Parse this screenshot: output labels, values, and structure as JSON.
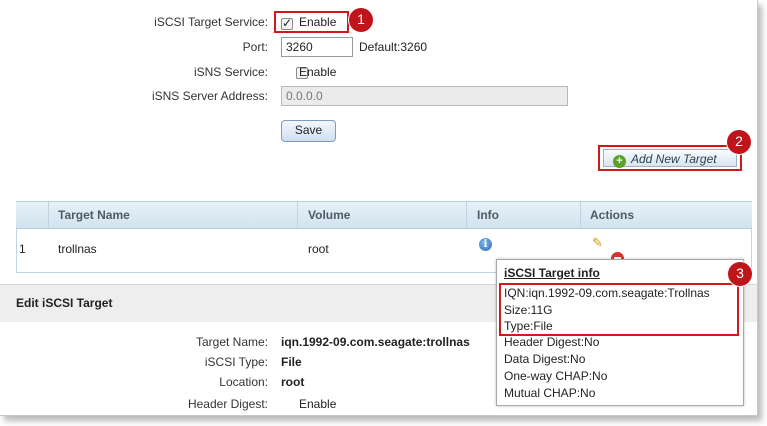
{
  "service": {
    "target_service_label": "iSCSI Target Service:",
    "target_service_enable": "Enable",
    "port_label": "Port:",
    "port_value": "3260",
    "port_default": "Default:3260",
    "isns_label": "iSNS Service:",
    "isns_enable": "Enable",
    "isns_server_label": "iSNS Server Address:",
    "isns_server_value": "0.0.0.0",
    "save_label": "Save"
  },
  "add_target_label": "Add New Target",
  "callouts": [
    "1",
    "2",
    "3"
  ],
  "table": {
    "headers": [
      "Target Name",
      "Volume",
      "Info",
      "Actions"
    ],
    "rows": [
      {
        "index": "1",
        "name": "trollnas",
        "volume": "root"
      }
    ]
  },
  "edit": {
    "title": "Edit iSCSI Target",
    "target_name_label": "Target Name:",
    "target_name_value": "iqn.1992-09.com.seagate:trollnas",
    "type_label": "iSCSI Type:",
    "type_value": "File",
    "location_label": "Location:",
    "location_value": "root",
    "header_digest_label": "Header Digest:",
    "header_digest_enable": "Enable"
  },
  "popup": {
    "title": "iSCSI Target info",
    "lines": [
      "IQN:iqn.1992-09.com.seagate:Trollnas",
      "Size:11G",
      "Type:File",
      "Header Digest:No",
      "Data Digest:No",
      "One-way CHAP:No",
      "Mutual CHAP:No"
    ]
  },
  "colors": {
    "callout": "#c0141b",
    "highlight_border": "#d01a1a",
    "table_header": "#d2e3ef"
  }
}
